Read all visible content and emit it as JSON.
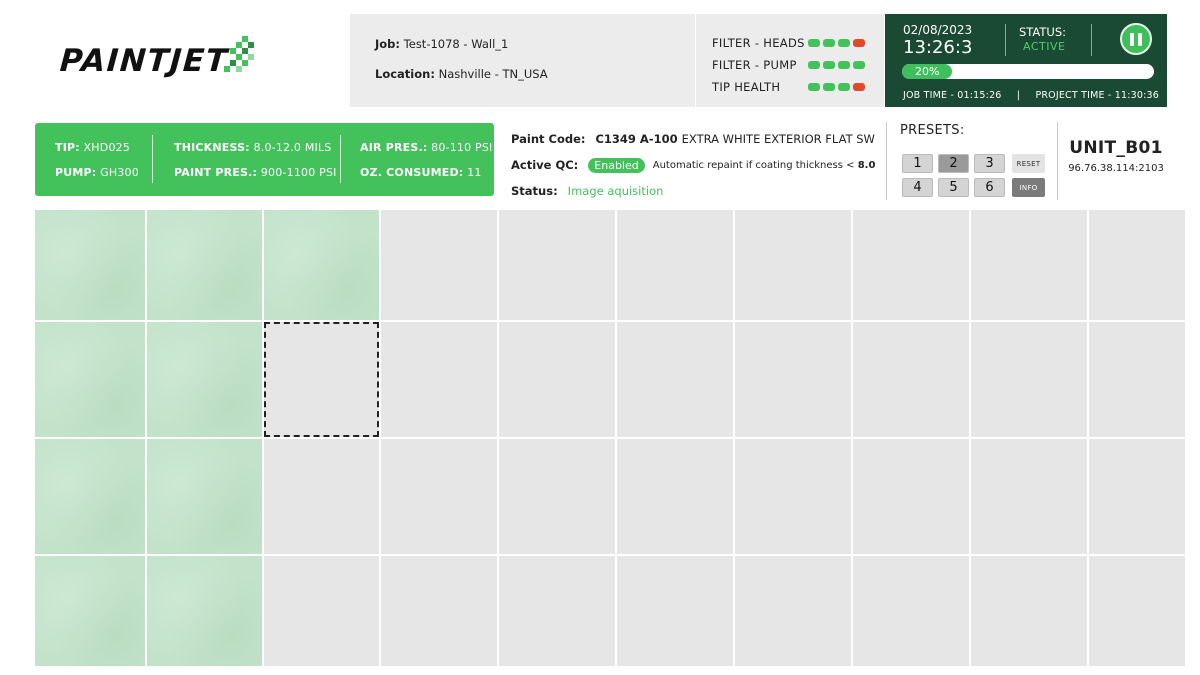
{
  "brand": {
    "logo_text": "PAINTJET",
    "colors": {
      "accent_green": "#43c25c",
      "dark_green": "#1a4a34",
      "alert_red": "#e04a2a",
      "painted_cell": "#c2e3ca",
      "empty_cell": "#e6e6e7"
    }
  },
  "job": {
    "job_label": "Job:",
    "job_value": "Test-1078 - Wall_1",
    "location_label": "Location:",
    "location_value": "Nashville  -  TN_USA"
  },
  "filters": [
    {
      "label": "FILTER - HEADS",
      "dots": [
        "green",
        "green",
        "green",
        "red"
      ]
    },
    {
      "label": "FILTER - PUMP",
      "dots": [
        "green",
        "green",
        "green",
        "green"
      ]
    },
    {
      "label": "TIP HEALTH",
      "dots": [
        "green",
        "green",
        "green",
        "red"
      ]
    }
  ],
  "status_panel": {
    "date": "02/08/2023",
    "time": "13:26:3",
    "status_label": "STATUS:",
    "status_value": "ACTIVE",
    "progress_percent": 20,
    "progress_text": "20%",
    "job_time": "JOB TIME - 01:15:26",
    "separator": "|",
    "project_time": "PROJECT TIME - 11:30:36",
    "pause_icon": "pause-icon"
  },
  "specs": {
    "tip_label": "TIP:",
    "tip_value": "XHD025",
    "pump_label": "PUMP:",
    "pump_value": "GH300",
    "thickness_label": "THICKNESS:",
    "thickness_value": "8.0-12.0 MILS",
    "paint_pres_label": "PAINT PRES.:",
    "paint_pres_value": "900-1100 PSI",
    "air_pres_label": "AIR PRES.:",
    "air_pres_value": "80-110 PSI",
    "oz_label": "OZ. CONSUMED:",
    "oz_value": "11"
  },
  "paint": {
    "code_label": "Paint Code:",
    "code_value": "C1349 A-100",
    "code_desc": "EXTRA WHITE EXTERIOR FLAT SW",
    "qc_label": "Active QC:",
    "qc_pill": "Enabled",
    "qc_note": "Automatic repaint if coating thickness <",
    "qc_threshold": "8.0",
    "status_label": "Status:",
    "status_value": "Image aquisition"
  },
  "presets": {
    "label": "PRESETS:",
    "buttons": [
      "1",
      "2",
      "3",
      "4",
      "5",
      "6"
    ],
    "active": "2",
    "reset_label": "RESET",
    "info_label": "INFO"
  },
  "unit": {
    "name": "UNIT_B01",
    "ip": "96.76.38.114:2103"
  },
  "wall_grid": {
    "rows": 4,
    "cols": 10,
    "painted": [
      [
        0,
        0
      ],
      [
        0,
        1
      ],
      [
        0,
        2
      ],
      [
        1,
        0
      ],
      [
        1,
        1
      ],
      [
        2,
        0
      ],
      [
        2,
        1
      ],
      [
        3,
        0
      ],
      [
        3,
        1
      ]
    ],
    "current": [
      1,
      2
    ]
  }
}
